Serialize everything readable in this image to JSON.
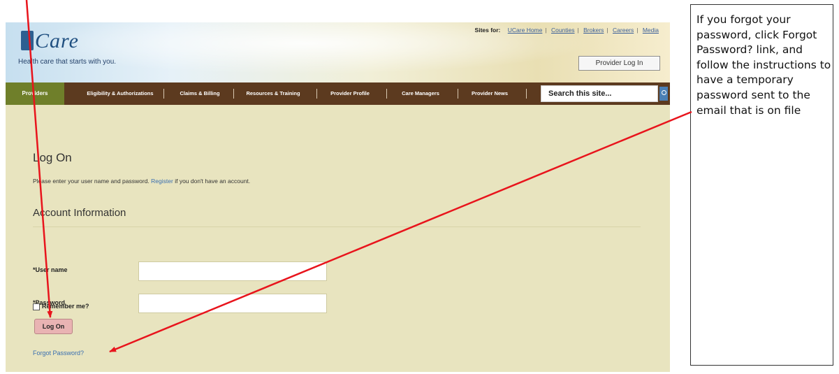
{
  "header": {
    "logo_text": "Care",
    "tagline": "Health care that starts with you.",
    "sites_for_label": "Sites for:",
    "site_links": [
      "UCare Home",
      "Counties",
      "Brokers",
      "Careers",
      "Media"
    ],
    "provider_login_label": "Provider Log In"
  },
  "nav": {
    "items": [
      {
        "label": "Providers"
      },
      {
        "label": "Eligibility & Authorizations"
      },
      {
        "label": "Claims & Billing"
      },
      {
        "label": "Resources & Training"
      },
      {
        "label": "Provider Profile"
      },
      {
        "label": "Care Managers"
      },
      {
        "label": "Provider News"
      }
    ],
    "search_placeholder": "Search this site..."
  },
  "form": {
    "title": "Log On",
    "intro_before": "Please enter your user name and password.",
    "register_link": "Register",
    "intro_after": "if you don't have an account.",
    "section_title": "Account Information",
    "username_label": "*User name",
    "password_label": "*Password",
    "remember_label": "Remember me?",
    "logon_button": "Log On",
    "forgot_link": "Forgot Password?"
  },
  "callout": {
    "text": "If you forgot your password, click Forgot Password? link, and follow the instructions to have a temporary password sent to the email that is on file"
  },
  "colors": {
    "page_bg": "#e8e4bf",
    "nav_bg": "#5c3a1f",
    "nav_active": "#6f7f2a",
    "link": "#3a6fb0",
    "arrow": "#e8141c"
  }
}
